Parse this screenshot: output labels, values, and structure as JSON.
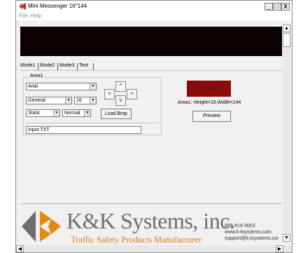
{
  "window": {
    "title": "Mini Messenger  16*144",
    "controls": {
      "minimize": "_",
      "maximize": "□",
      "close": "X"
    }
  },
  "menu": {
    "items": [
      "File",
      "Help"
    ]
  },
  "tabs": [
    "Mode1",
    "Mode2",
    "Mode3",
    "Test"
  ],
  "area_group": {
    "label": "Area1",
    "font_select": "Arial",
    "style_select": "General",
    "size_select": "16",
    "effect_select": "Static",
    "speed_select": "Normal",
    "load_bmp_label": "Load Bmp",
    "arrows": {
      "up": "^",
      "down": "v",
      "left": "<",
      "right": ">"
    },
    "text_input_value": "Input TXT"
  },
  "preview": {
    "box_label": "Area1",
    "area_info": "Area1: Height=16,Width=144",
    "button_label": "Preview"
  },
  "footer": {
    "brand_name": "K&K Systems, inc.",
    "tagline": "Traffic Safety Products Manufacturer",
    "phone": "888-414-3003",
    "website": "www.k-ksystems.com",
    "email": "support@k-ksystems.cor"
  },
  "colors": {
    "led_background": "#0d0000",
    "preview_box": "#8b0a0a",
    "tagline": "#e07a16",
    "logo_gray": "#6e6e6e",
    "logo_orange": "#e8880d"
  },
  "icons": {
    "app": "kk-logo-icon",
    "scroll_up": "scroll-up-arrow-icon",
    "scroll_down": "scroll-down-arrow-icon",
    "scroll_left": "scroll-left-arrow-icon",
    "scroll_right": "scroll-right-arrow-icon"
  }
}
